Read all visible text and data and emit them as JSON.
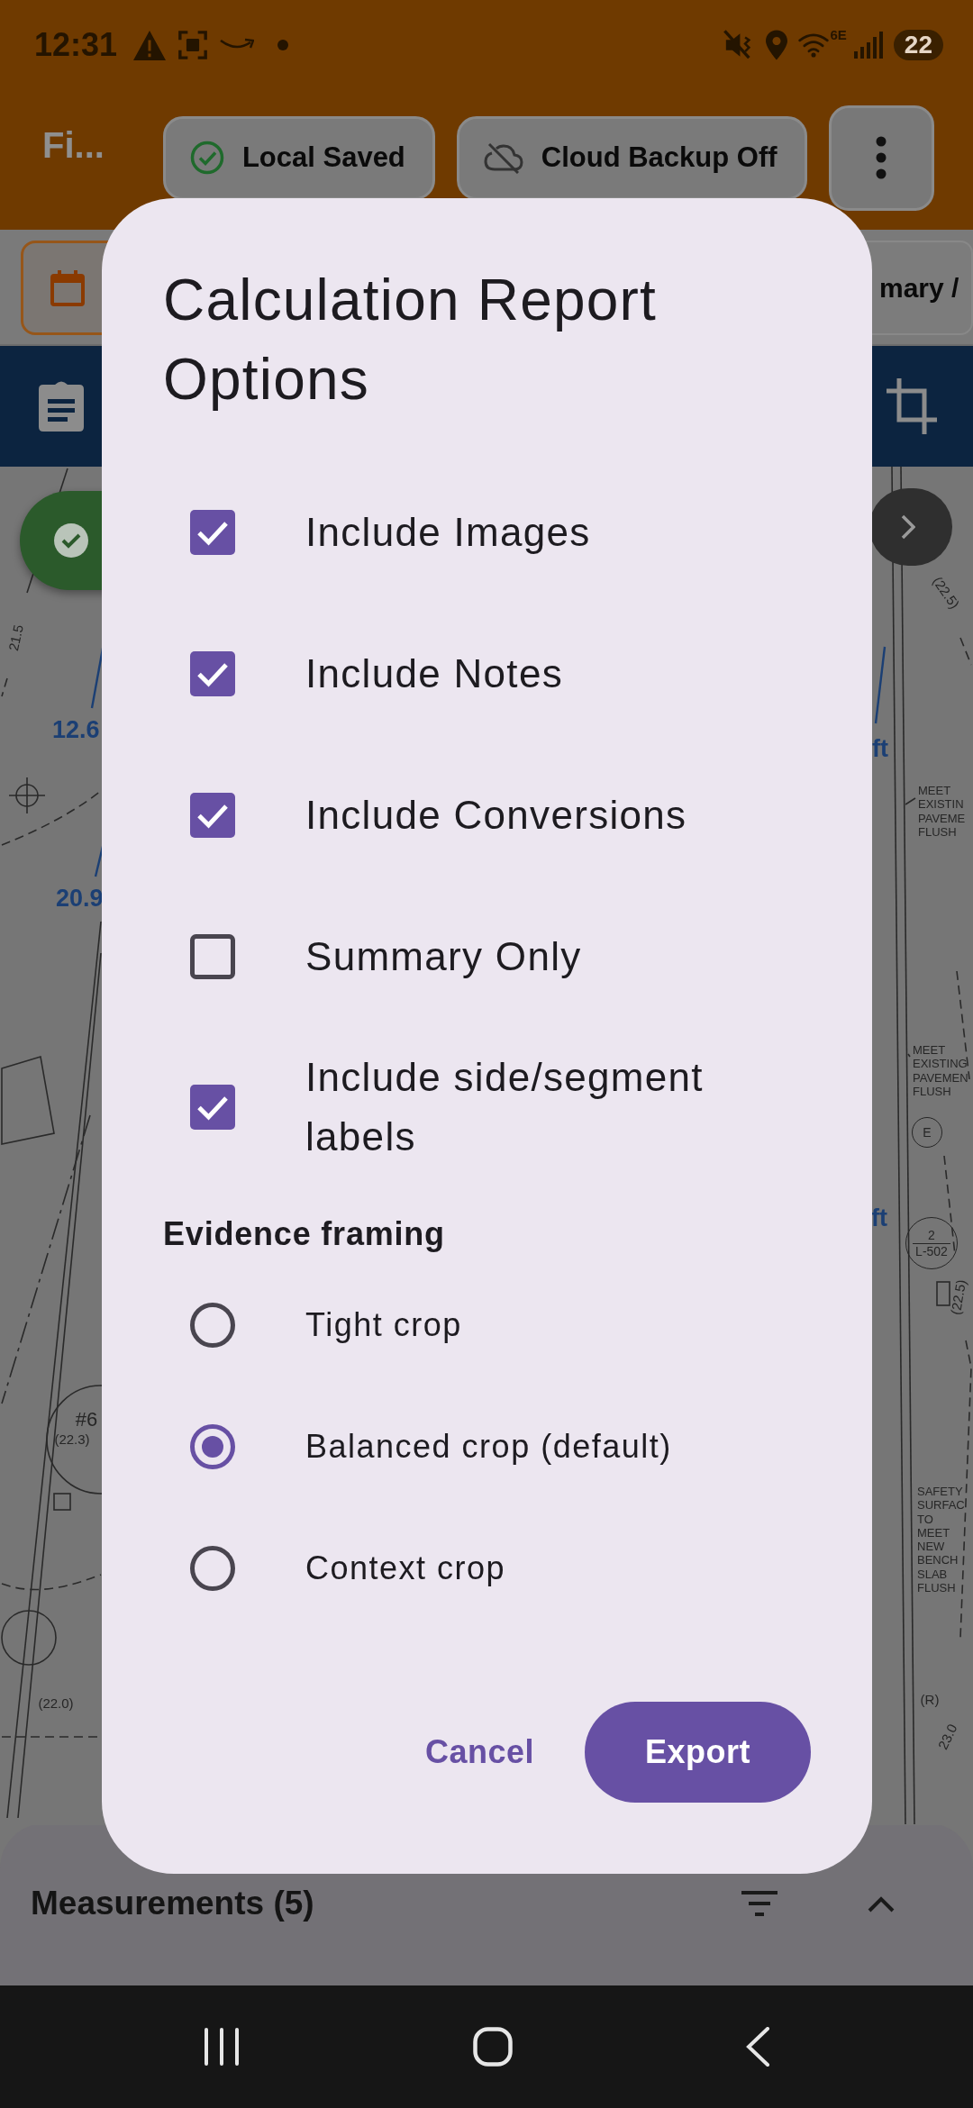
{
  "status_bar": {
    "time": "12:31",
    "network_label": "6E",
    "battery": "22"
  },
  "app_bar": {
    "title": "Fi...",
    "chips": [
      {
        "label": "Local Saved",
        "kind": "saved"
      },
      {
        "label": "Cloud Backup Off",
        "kind": "cloud_off"
      }
    ]
  },
  "filter_bar": {
    "chip_text": "mary /"
  },
  "canvas": {
    "measurement_labels": [
      "12.6",
      "20.9",
      "ft",
      "ft"
    ],
    "plan_labels": [
      {
        "kind": "dim",
        "text": "(22.5)"
      },
      {
        "kind": "dim",
        "text": "21.5"
      },
      {
        "kind": "note",
        "lines": [
          "MEET",
          "EXISTIN",
          "PAVEME",
          "FLUSH"
        ]
      },
      {
        "kind": "note",
        "lines": [
          "MEET",
          "EXISTING",
          "PAVEMEN",
          "FLUSH"
        ]
      },
      {
        "kind": "tag",
        "lines": [
          "E"
        ]
      },
      {
        "kind": "tag",
        "lines": [
          "2",
          "L-502"
        ]
      },
      {
        "kind": "dim",
        "text": "(22.5)"
      },
      {
        "kind": "mark",
        "text": "#6"
      },
      {
        "kind": "dim",
        "text": "(22.3)"
      },
      {
        "kind": "note",
        "lines": [
          "SAFETY",
          "SURFAC",
          "TO",
          "MEET",
          "NEW",
          "BENCH",
          "SLAB",
          "FLUSH"
        ]
      },
      {
        "kind": "dim",
        "text": "(R)"
      },
      {
        "kind": "dim",
        "text": "(22.0)"
      },
      {
        "kind": "dim",
        "text": "23.0"
      }
    ]
  },
  "dialog": {
    "title": "Calculation Report Options",
    "options": [
      {
        "label": "Include Images",
        "checked": true
      },
      {
        "label": "Include Notes",
        "checked": true
      },
      {
        "label": "Include Conversions",
        "checked": true
      },
      {
        "label": "Summary Only",
        "checked": false
      },
      {
        "label": "Include side/segment labels",
        "checked": true
      }
    ],
    "section_title": "Evidence framing",
    "framing": [
      {
        "label": "Tight crop",
        "selected": false
      },
      {
        "label": "Balanced crop (default)",
        "selected": true
      },
      {
        "label": "Context crop",
        "selected": false
      }
    ],
    "actions": [
      {
        "label": "Cancel",
        "kind": "dismiss"
      },
      {
        "label": "Export",
        "kind": "confirm"
      }
    ]
  },
  "bottom_sheet": {
    "title": "Measurements (5)"
  }
}
